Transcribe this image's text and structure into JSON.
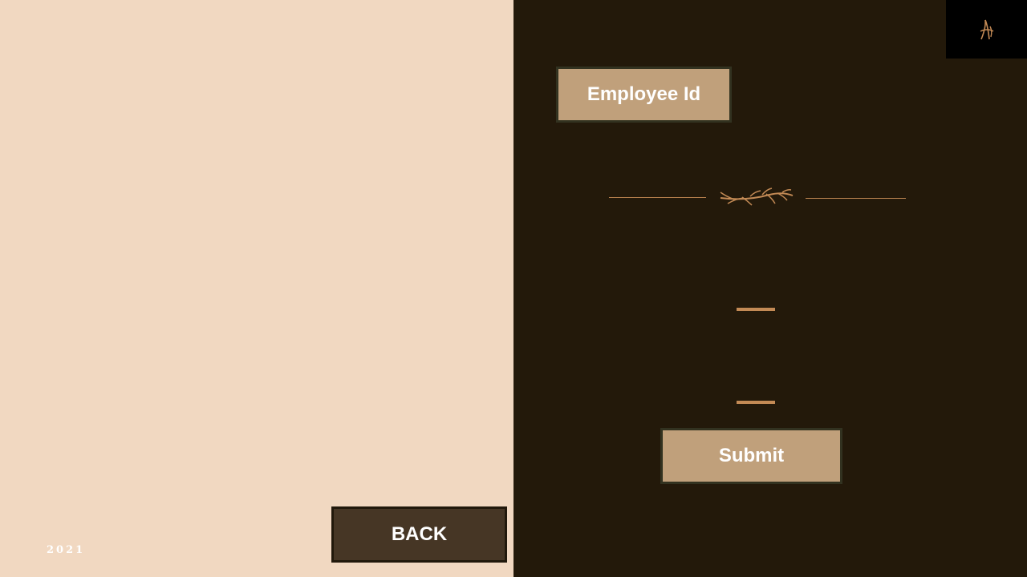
{
  "left_panel": {
    "year": "2021",
    "back_label": "BACK"
  },
  "right_panel": {
    "employee_id_label": "Employee Id",
    "submit_label": "Submit"
  },
  "colors": {
    "left_background": "#f1d8c1",
    "right_background": "#23190a",
    "button_fill": "#c0a07b",
    "back_button_fill": "#463625",
    "accent": "#c38a55",
    "logo_box": "#000000"
  },
  "icons": {
    "logo": "monogram-logo-icon",
    "ornament": "branch-icon"
  }
}
